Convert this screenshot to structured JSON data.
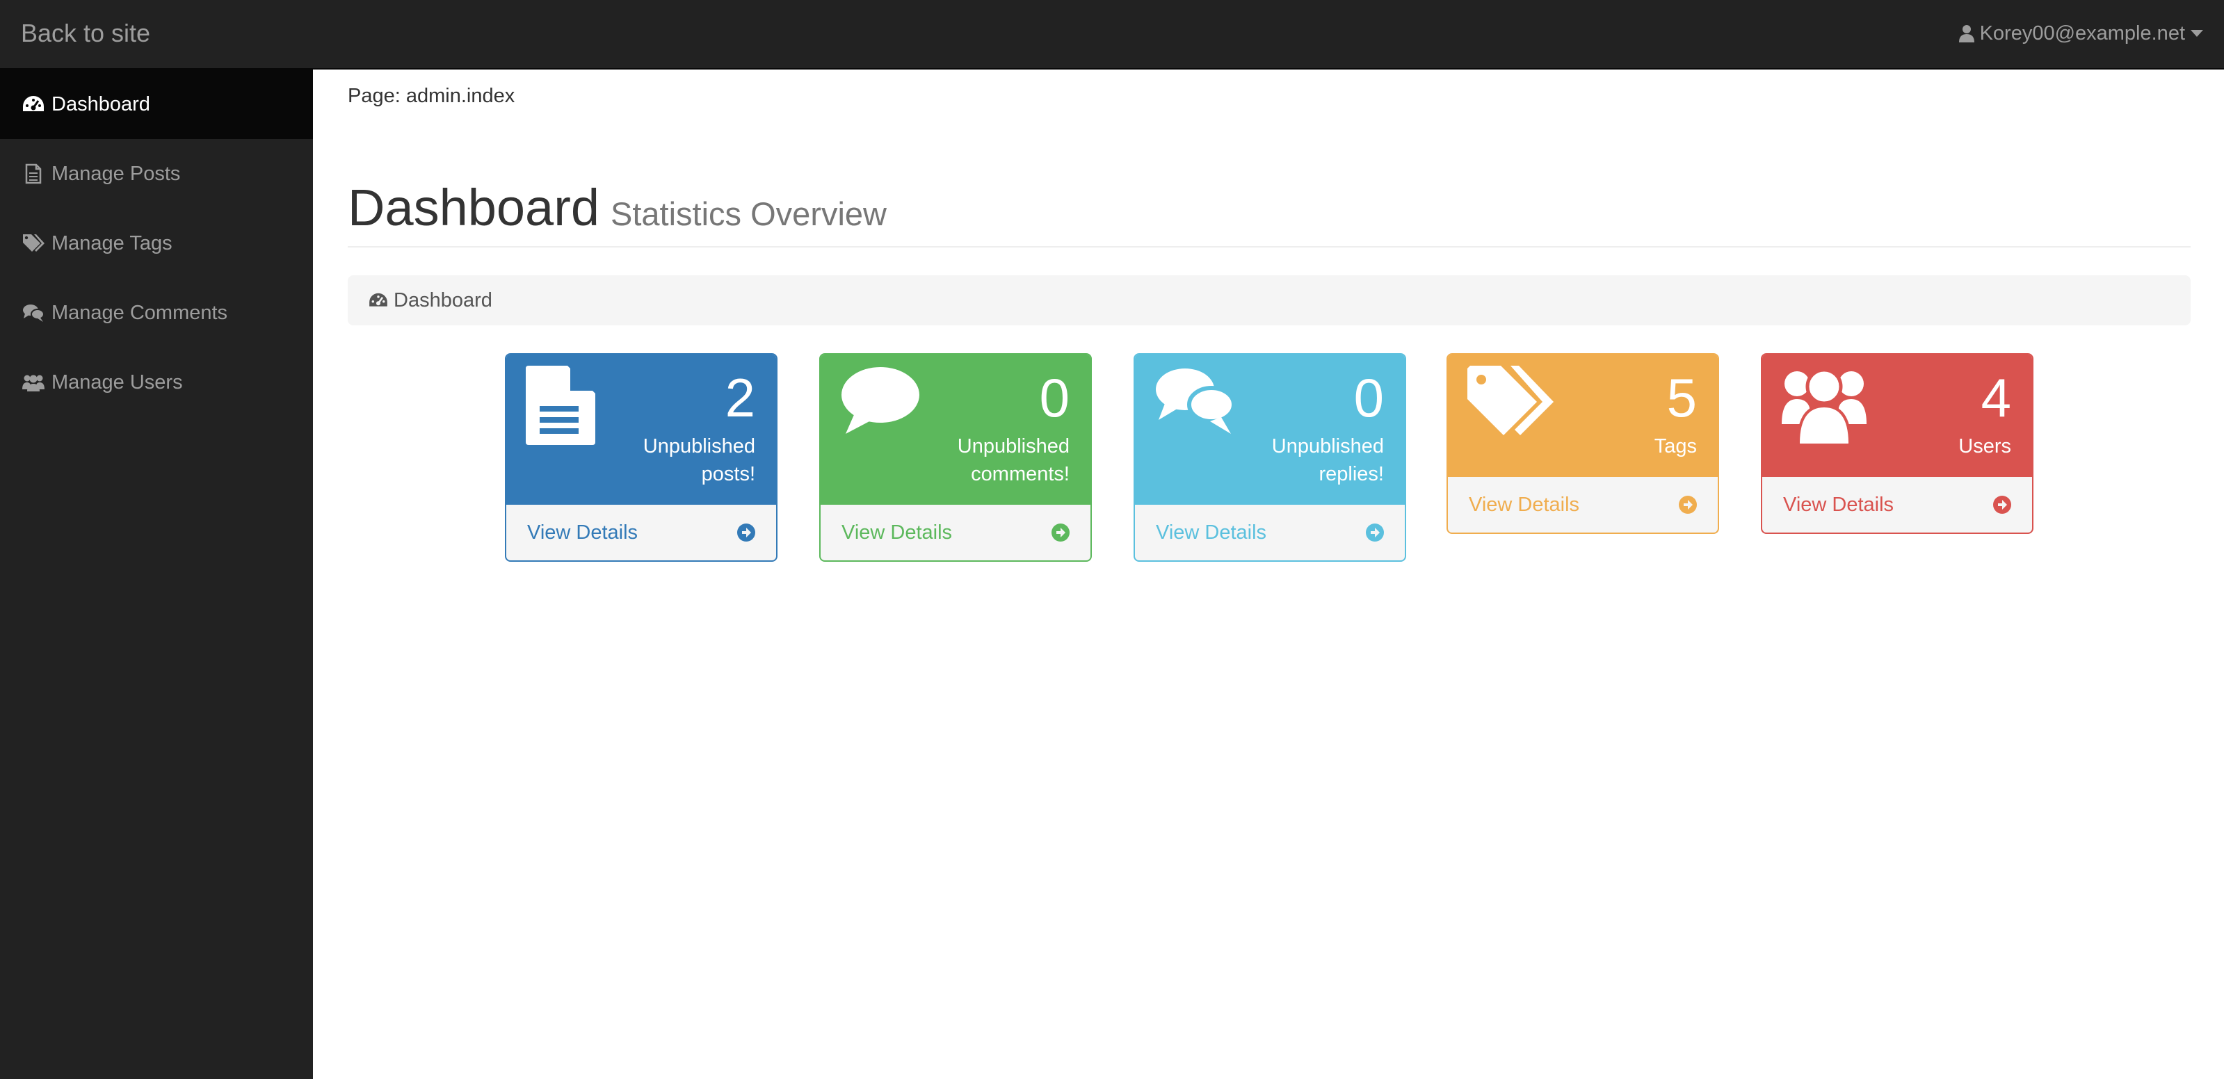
{
  "navbar": {
    "brand_label": "Back to site",
    "user_label": "Korey00@example.net"
  },
  "sidebar": {
    "items": [
      {
        "label": "Dashboard",
        "icon": "dashboard-icon",
        "active": true
      },
      {
        "label": "Manage Posts",
        "icon": "file-icon",
        "active": false
      },
      {
        "label": "Manage Tags",
        "icon": "tags-icon",
        "active": false
      },
      {
        "label": "Manage Comments",
        "icon": "comments-icon",
        "active": false
      },
      {
        "label": "Manage Users",
        "icon": "users-icon",
        "active": false
      }
    ]
  },
  "main": {
    "page_label": "Page: admin.index",
    "title": "Dashboard",
    "subtitle": "Statistics Overview",
    "breadcrumb": "Dashboard"
  },
  "cards": [
    {
      "count": "2",
      "label_line1": "Unpublished",
      "label_line2": "posts!",
      "link": "View Details",
      "color": "#337ab7",
      "icon": "file-text-icon"
    },
    {
      "count": "0",
      "label_line1": "Unpublished",
      "label_line2": "comments!",
      "link": "View Details",
      "color": "#5cb85c",
      "icon": "comment-icon"
    },
    {
      "count": "0",
      "label_line1": "Unpublished",
      "label_line2": "replies!",
      "link": "View Details",
      "color": "#5bc0de",
      "icon": "comments-icon"
    },
    {
      "count": "5",
      "label_line1": "Tags",
      "label_line2": "",
      "link": "View Details",
      "color": "#f0ad4e",
      "icon": "tags-icon"
    },
    {
      "count": "4",
      "label_line1": "Users",
      "label_line2": "",
      "link": "View Details",
      "color": "#d9534f",
      "icon": "users-icon"
    }
  ]
}
